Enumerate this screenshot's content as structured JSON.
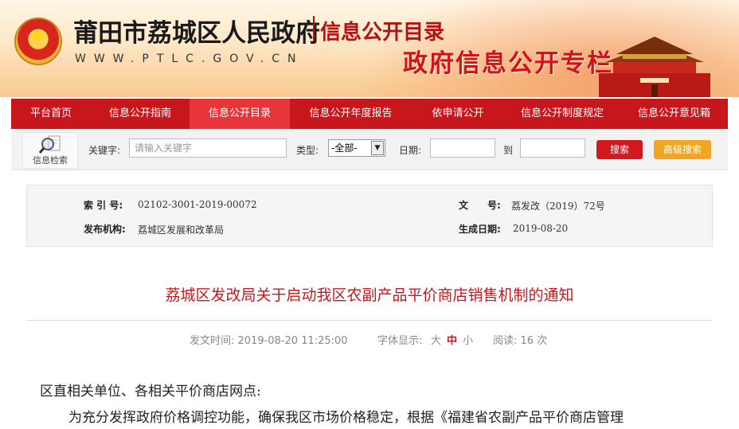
{
  "header": {
    "site_title": "莆田市荔城区人民政府",
    "section_title": "信息公开目录",
    "url": "WWW.PTLC.GOV.CN",
    "slogan": "政府信息公开专栏"
  },
  "nav": {
    "items": [
      {
        "label": "平台首页"
      },
      {
        "label": "信息公开指南"
      },
      {
        "label": "信息公开目录"
      },
      {
        "label": "信息公开年度报告"
      },
      {
        "label": "依申请公开"
      },
      {
        "label": "信息公开制度规定"
      },
      {
        "label": "信息公开意见箱"
      }
    ],
    "active_index": 2
  },
  "search": {
    "logo_text": "信息检索",
    "keyword_label": "关键字:",
    "keyword_placeholder": "请输入关键字",
    "type_label": "类型:",
    "type_selected": "-全部-",
    "date_label": "日期:",
    "to_label": "到",
    "search_button": "搜索",
    "advanced_button": "高级搜索"
  },
  "meta": {
    "index_label": "索 引 号:",
    "index_value": "02102-3001-2019-00072",
    "doc_label": "文　　号:",
    "doc_value": "荔发改（2019）72号",
    "org_label": "发布机构:",
    "org_value": "荔城区发展和改革局",
    "date_label": "生成日期:",
    "date_value": "2019-08-20"
  },
  "article": {
    "title": "荔城区发改局关于启动我区农副产品平价商店销售机制的通知",
    "publish_time": "发文时间: 2019-08-20 11:25:00",
    "font_label": "字体显示:",
    "font_large": "大",
    "font_medium": "中",
    "font_small": "小",
    "views": "阅读: 16 次",
    "para1": "区直相关单位、各相关平价商店网点:",
    "para2": "为充分发挥政府价格调控功能，确保我区市场价格稳定，根据《福建省农副产品平价商店管理"
  },
  "colors": {
    "nav_red": "#c8161d",
    "nav_active": "#e8353a",
    "search_btn": "#d1191f",
    "advanced_btn": "#f0a623",
    "title_red": "#c8161d"
  }
}
